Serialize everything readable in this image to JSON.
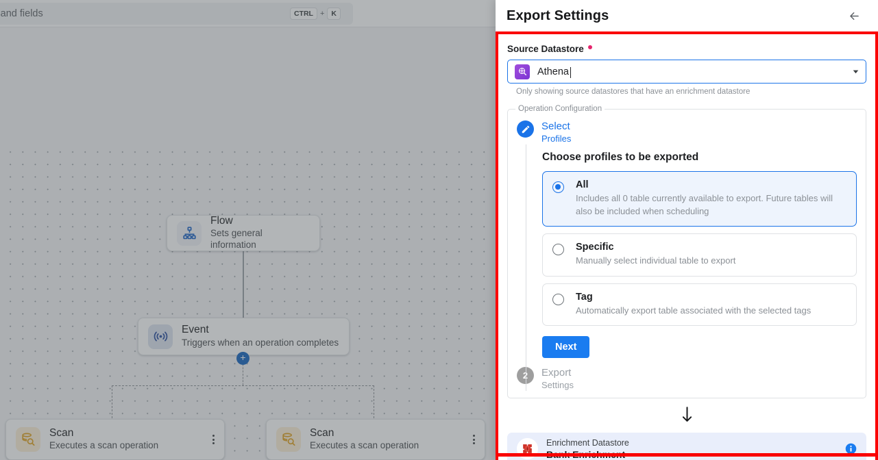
{
  "canvas": {
    "search": {
      "placeholder": "Search datastores, containers and fields",
      "kbd_mod": "CTRL",
      "kbd_plus": "+",
      "kbd_key": "K"
    },
    "nodes": [
      {
        "title": "Flow",
        "subtitle": "Sets general information",
        "icon": "flow-hierarchy-icon",
        "kebab": false
      },
      {
        "title": "Event",
        "subtitle": "Triggers when an operation completes",
        "icon": "event-broadcast-icon",
        "kebab": false
      },
      {
        "title": "Scan",
        "subtitle": "Executes a scan operation",
        "icon": "scan-database-icon",
        "kebab": true
      },
      {
        "title": "Scan",
        "subtitle": "Executes a scan operation",
        "icon": "scan-database-icon",
        "kebab": true
      }
    ],
    "add_node_label": "+"
  },
  "panel": {
    "title": "Export Settings",
    "back_icon": "arrow-left-icon",
    "highlight_color": "#fa0000",
    "source_datastore": {
      "label": "Source Datastore",
      "required": true,
      "value": "Athena",
      "icon": "athena-datastore-icon",
      "caret_icon": "chevron-down-icon",
      "helper_text": "Only showing source datastores that have an enrichment datastore"
    },
    "operation_configuration": {
      "legend": "Operation Configuration",
      "steps": [
        {
          "num": "1",
          "icon": "pencil-edit-icon",
          "line1": "Select",
          "line2": "Profiles",
          "state": "active"
        },
        {
          "num": "2",
          "icon": "step-number-2",
          "line1": "Export",
          "line2": "Settings",
          "state": "inactive"
        }
      ],
      "choose_heading": "Choose profiles to be exported",
      "options": [
        {
          "title": "All",
          "description": "Includes all 0 table currently available to export. Future tables will also be included when scheduling",
          "selected": true
        },
        {
          "title": "Specific",
          "description": "Manually select individual table to export",
          "selected": false
        },
        {
          "title": "Tag",
          "description": "Automatically export table associated with the selected tags",
          "selected": false
        }
      ],
      "next_label": "Next"
    },
    "flow_arrow_icon": "arrow-down-icon",
    "enrichment": {
      "caption": "Enrichment Datastore",
      "name": "Bank Enrichment",
      "icon": "sqlserver-datastore-icon",
      "info_icon": "info-circle-icon"
    }
  }
}
